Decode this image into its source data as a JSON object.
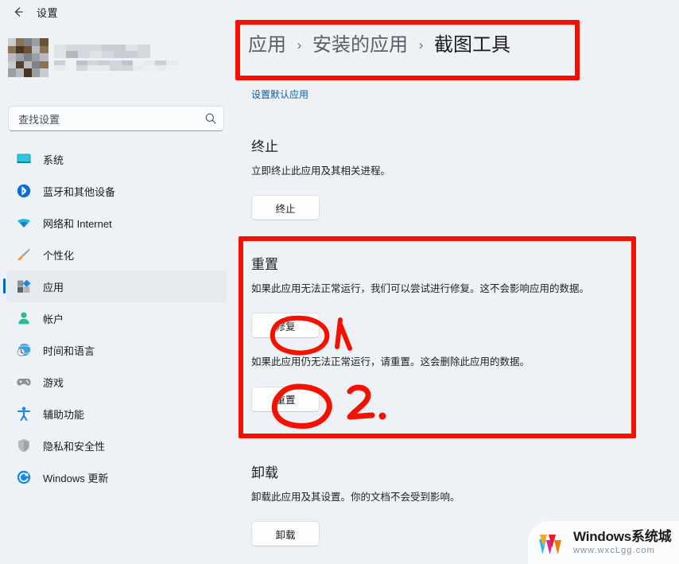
{
  "window": {
    "title": "设置",
    "back_icon": "back-arrow-icon"
  },
  "sidebar": {
    "search": {
      "placeholder": "查找设置",
      "icon": "search-icon"
    },
    "items": [
      {
        "label": "系统",
        "icon": "monitor-icon",
        "selected": false
      },
      {
        "label": "蓝牙和其他设备",
        "icon": "bluetooth-icon",
        "selected": false
      },
      {
        "label": "网络和 Internet",
        "icon": "wifi-icon",
        "selected": false
      },
      {
        "label": "个性化",
        "icon": "paintbrush-icon",
        "selected": false
      },
      {
        "label": "应用",
        "icon": "apps-icon",
        "selected": true
      },
      {
        "label": "帐户",
        "icon": "account-icon",
        "selected": false
      },
      {
        "label": "时间和语言",
        "icon": "clock-globe-icon",
        "selected": false
      },
      {
        "label": "游戏",
        "icon": "gamepad-icon",
        "selected": false
      },
      {
        "label": "辅助功能",
        "icon": "accessibility-icon",
        "selected": false
      },
      {
        "label": "隐私和安全性",
        "icon": "shield-icon",
        "selected": false
      },
      {
        "label": "Windows 更新",
        "icon": "update-icon",
        "selected": false
      }
    ]
  },
  "content": {
    "breadcrumb": {
      "crumb1": "应用",
      "sep1": "›",
      "crumb2": "安装的应用",
      "sep2": "›",
      "crumb3": "截图工具"
    },
    "default_apps_link": "设置默认应用",
    "terminate": {
      "heading": "终止",
      "description": "立即终止此应用及其相关进程。",
      "button": "终止"
    },
    "reset": {
      "heading": "重置",
      "description_repair": "如果此应用无法正常运行，我们可以尝试进行修复。这不会影响应用的数据。",
      "button_repair": "修复",
      "description_reset": "如果此应用仍无法正常运行，请重置。这会删除此应用的数据。",
      "button_reset": "重置"
    },
    "uninstall": {
      "heading": "卸载",
      "description": "卸载此应用及其设置。你的文档不会受到影响。",
      "button": "卸载"
    }
  },
  "annotations": {
    "color": "#f51000",
    "step1_label": "1",
    "step2_label": "2.",
    "boxes": [
      "breadcrumb-highlight",
      "reset-section-highlight"
    ],
    "circles": [
      "repair-button-circle",
      "reset-button-circle"
    ]
  },
  "watermark": {
    "title": "Windows系统城",
    "url": "www.wxcLgg.com",
    "logo_colors": [
      "#f5a623",
      "#29b6e8",
      "#e0218a",
      "#ed1c24",
      "#f57c00"
    ]
  }
}
